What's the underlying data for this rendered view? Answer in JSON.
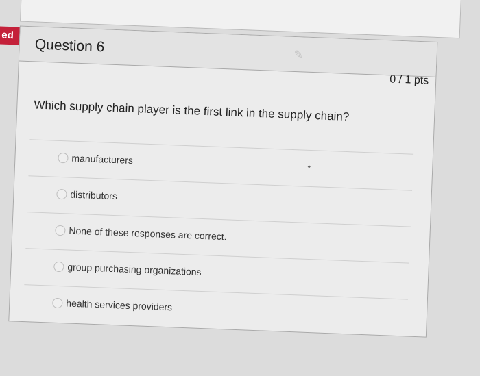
{
  "sidebar": {
    "badge_text": "ed"
  },
  "question": {
    "title": "Question 6",
    "points": "0 / 1 pts",
    "prompt": "Which supply chain player is the first link in the supply chain?",
    "answers": [
      {
        "label": "manufacturers"
      },
      {
        "label": "distributors"
      },
      {
        "label": "None of these responses are correct."
      },
      {
        "label": "group purchasing organizations"
      },
      {
        "label": "health services providers"
      }
    ]
  },
  "colors": {
    "badge": "#c4213a",
    "card_bg": "#ececec",
    "border": "#a9a9a9"
  },
  "icons": {
    "edit": "pencil-icon"
  }
}
